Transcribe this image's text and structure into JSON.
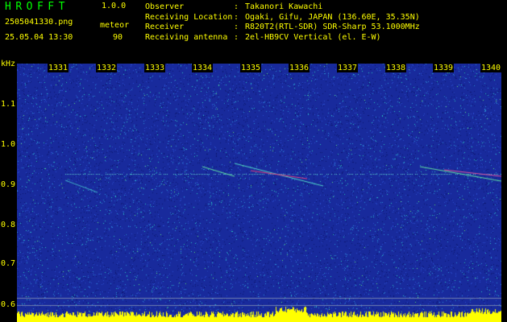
{
  "header": {
    "logo": "HROFFT",
    "version": "1.0.0",
    "filename": "2505041330.png",
    "datetime": "25.05.04 13:30",
    "mode": "meteor",
    "count": "90"
  },
  "station": {
    "rows": [
      {
        "label": "Observer",
        "value": "Takanori Kawachi"
      },
      {
        "label": "Receiving Location",
        "value": "Ogaki, Gifu, JAPAN (136.60E, 35.35N)"
      },
      {
        "label": "Receiver",
        "value": "R820T2(RTL-SDR) SDR-Sharp 53.1000MHz"
      },
      {
        "label": "Receiving antenna",
        "value": "2el-HB9CV Vertical (el. E-W)"
      }
    ],
    "separator": ":"
  },
  "spectrogram": {
    "unit": "kHz",
    "y_ticks": [
      "1.1",
      "1.0",
      "0.9",
      "0.8",
      "0.7",
      "0.6"
    ],
    "x_ticks": [
      "1331",
      "1332",
      "1333",
      "1334",
      "1335",
      "1336",
      "1337",
      "1338",
      "1339",
      "1340"
    ],
    "y_range_khz": [
      0.6,
      1.1
    ],
    "colors": {
      "background": "#1a2ea8",
      "label": "#ffff00",
      "logo": "#00ff00",
      "signal": "#ffff00"
    }
  }
}
